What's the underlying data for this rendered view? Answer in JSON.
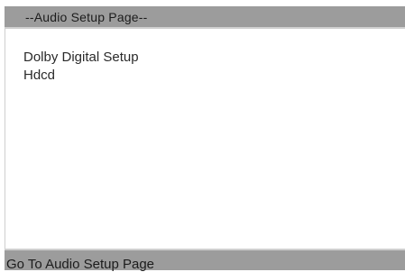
{
  "header": {
    "title": "--Audio Setup Page--"
  },
  "menu": {
    "items": [
      {
        "label": "Dolby Digital Setup"
      },
      {
        "label": "Hdcd"
      }
    ]
  },
  "footer": {
    "status": "Go To Audio Setup Page"
  },
  "colors": {
    "bar_background": "#9c9c9c",
    "panel_background": "#ffffff",
    "text": "#2a2a2a"
  }
}
